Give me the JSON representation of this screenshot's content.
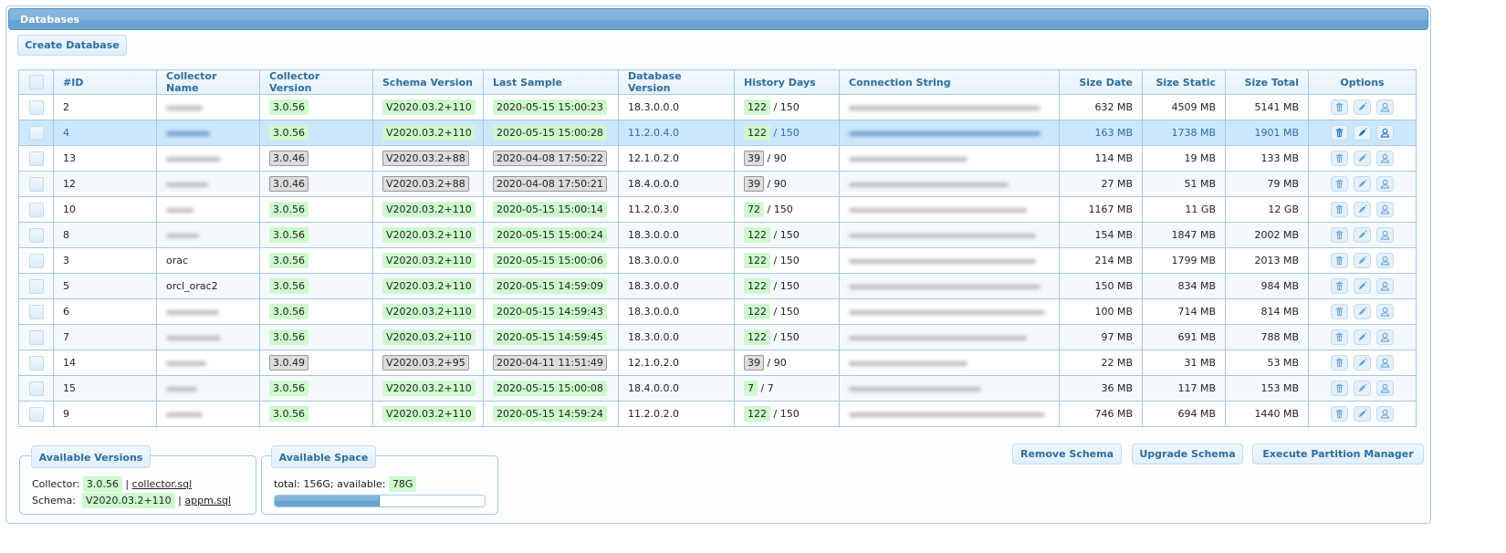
{
  "panel": {
    "title": "Databases"
  },
  "toolbar": {
    "create_label": "Create Database"
  },
  "table": {
    "columns": [
      "",
      "#ID",
      "Collector Name",
      "Collector Version",
      "Schema Version",
      "Last Sample",
      "Database Version",
      "History Days",
      "Connection String",
      "Size Date",
      "Size Static",
      "Size Total",
      "Options"
    ],
    "rows": [
      {
        "id": "2",
        "name": "",
        "name_hidden": true,
        "collector_version": "3.0.56",
        "collector_ok": true,
        "schema_version": "V2020.03.2+110",
        "schema_ok": true,
        "last_sample": "2020-05-15 15:00:23",
        "sample_ok": true,
        "db_version": "18.3.0.0.0",
        "history_days": "122",
        "history_max": "/ 150",
        "history_ok": true,
        "conn_hidden": true,
        "size_date": "632 MB",
        "size_static": "4509 MB",
        "size_total": "5141 MB"
      },
      {
        "id": "4",
        "name": "",
        "name_hidden": true,
        "selected": true,
        "collector_version": "3.0.56",
        "collector_ok": true,
        "schema_version": "V2020.03.2+110",
        "schema_ok": true,
        "last_sample": "2020-05-15 15:00:28",
        "sample_ok": true,
        "db_version": "11.2.0.4.0",
        "history_days": "122",
        "history_max": "/ 150",
        "history_ok": true,
        "conn_hidden": true,
        "size_date": "163 MB",
        "size_static": "1738 MB",
        "size_total": "1901 MB"
      },
      {
        "id": "13",
        "name": "",
        "name_hidden": true,
        "collector_version": "3.0.46",
        "collector_ok": false,
        "schema_version": "V2020.03.2+88",
        "schema_ok": false,
        "last_sample": "2020-04-08 17:50:22",
        "sample_ok": false,
        "db_version": "12.1.0.2.0",
        "history_days": "39",
        "history_max": "/ 90",
        "history_ok": false,
        "conn_hidden": true,
        "size_date": "114 MB",
        "size_static": "19 MB",
        "size_total": "133 MB"
      },
      {
        "id": "12",
        "name": "",
        "name_hidden": true,
        "collector_version": "3.0.46",
        "collector_ok": false,
        "schema_version": "V2020.03.2+88",
        "schema_ok": false,
        "last_sample": "2020-04-08 17:50:21",
        "sample_ok": false,
        "db_version": "18.4.0.0.0",
        "history_days": "39",
        "history_max": "/ 90",
        "history_ok": false,
        "conn_hidden": true,
        "size_date": "27 MB",
        "size_static": "51 MB",
        "size_total": "79 MB"
      },
      {
        "id": "10",
        "name": "",
        "name_hidden": true,
        "collector_version": "3.0.56",
        "collector_ok": true,
        "schema_version": "V2020.03.2+110",
        "schema_ok": true,
        "last_sample": "2020-05-15 15:00:14",
        "sample_ok": true,
        "db_version": "11.2.0.3.0",
        "history_days": "72",
        "history_max": "/ 150",
        "history_ok": true,
        "conn_hidden": true,
        "size_date": "1167 MB",
        "size_static": "11 GB",
        "size_total": "12 GB"
      },
      {
        "id": "8",
        "name": "",
        "name_hidden": true,
        "collector_version": "3.0.56",
        "collector_ok": true,
        "schema_version": "V2020.03.2+110",
        "schema_ok": true,
        "last_sample": "2020-05-15 15:00:24",
        "sample_ok": true,
        "db_version": "18.3.0.0.0",
        "history_days": "122",
        "history_max": "/ 150",
        "history_ok": true,
        "conn_hidden": true,
        "size_date": "154 MB",
        "size_static": "1847 MB",
        "size_total": "2002 MB"
      },
      {
        "id": "3",
        "name": "orac",
        "name_hidden": false,
        "collector_version": "3.0.56",
        "collector_ok": true,
        "schema_version": "V2020.03.2+110",
        "schema_ok": true,
        "last_sample": "2020-05-15 15:00:06",
        "sample_ok": true,
        "db_version": "18.3.0.0.0",
        "history_days": "122",
        "history_max": "/ 150",
        "history_ok": true,
        "conn_hidden": true,
        "size_date": "214 MB",
        "size_static": "1799 MB",
        "size_total": "2013 MB"
      },
      {
        "id": "5",
        "name": "orcl_orac2",
        "name_hidden": false,
        "collector_version": "3.0.56",
        "collector_ok": true,
        "schema_version": "V2020.03.2+110",
        "schema_ok": true,
        "last_sample": "2020-05-15 14:59:09",
        "sample_ok": true,
        "db_version": "18.3.0.0.0",
        "history_days": "122",
        "history_max": "/ 150",
        "history_ok": true,
        "conn_hidden": true,
        "size_date": "150 MB",
        "size_static": "834 MB",
        "size_total": "984 MB"
      },
      {
        "id": "6",
        "name": "",
        "name_hidden": true,
        "collector_version": "3.0.56",
        "collector_ok": true,
        "schema_version": "V2020.03.2+110",
        "schema_ok": true,
        "last_sample": "2020-05-15 14:59:43",
        "sample_ok": true,
        "db_version": "18.3.0.0.0",
        "history_days": "122",
        "history_max": "/ 150",
        "history_ok": true,
        "conn_hidden": true,
        "size_date": "100 MB",
        "size_static": "714 MB",
        "size_total": "814 MB"
      },
      {
        "id": "7",
        "name": "",
        "name_hidden": true,
        "collector_version": "3.0.56",
        "collector_ok": true,
        "schema_version": "V2020.03.2+110",
        "schema_ok": true,
        "last_sample": "2020-05-15 14:59:45",
        "sample_ok": true,
        "db_version": "18.3.0.0.0",
        "history_days": "122",
        "history_max": "/ 150",
        "history_ok": true,
        "conn_hidden": true,
        "size_date": "97 MB",
        "size_static": "691 MB",
        "size_total": "788 MB"
      },
      {
        "id": "14",
        "name": "",
        "name_hidden": true,
        "collector_version": "3.0.49",
        "collector_ok": false,
        "schema_version": "V2020.03.2+95",
        "schema_ok": false,
        "last_sample": "2020-04-11 11:51:49",
        "sample_ok": false,
        "db_version": "12.1.0.2.0",
        "history_days": "39",
        "history_max": "/ 90",
        "history_ok": false,
        "conn_hidden": true,
        "size_date": "22 MB",
        "size_static": "31 MB",
        "size_total": "53 MB"
      },
      {
        "id": "15",
        "name": "",
        "name_hidden": true,
        "collector_version": "3.0.56",
        "collector_ok": true,
        "schema_version": "V2020.03.2+110",
        "schema_ok": true,
        "last_sample": "2020-05-15 15:00:08",
        "sample_ok": true,
        "db_version": "18.4.0.0.0",
        "history_days": "7",
        "history_max": "/ 7",
        "history_ok": true,
        "conn_hidden": true,
        "size_date": "36 MB",
        "size_static": "117 MB",
        "size_total": "153 MB"
      },
      {
        "id": "9",
        "name": "",
        "name_hidden": true,
        "collector_version": "3.0.56",
        "collector_ok": true,
        "schema_version": "V2020.03.2+110",
        "schema_ok": true,
        "last_sample": "2020-05-15 14:59:24",
        "sample_ok": true,
        "db_version": "11.2.0.2.0",
        "history_days": "122",
        "history_max": "/ 150",
        "history_ok": true,
        "conn_hidden": true,
        "size_date": "746 MB",
        "size_static": "694 MB",
        "size_total": "1440 MB"
      }
    ],
    "row_options": [
      {
        "name": "delete",
        "icon": "trash-icon"
      },
      {
        "name": "edit",
        "icon": "pencil-icon"
      },
      {
        "name": "user",
        "icon": "person-icon"
      }
    ]
  },
  "versions": {
    "title": "Available Versions",
    "collector_label": "Collector:",
    "collector_version": "3.0.56",
    "collector_file": "collector.sql",
    "schema_label": "Schema:",
    "schema_version": "V2020.03.2+110",
    "schema_file": "appm.sql",
    "separator": "|"
  },
  "space": {
    "title": "Available Space",
    "summary": "total: 156G; available:",
    "available": "78G",
    "used_fraction": 0.5
  },
  "actions": {
    "remove_schema": "Remove Schema",
    "upgrade_schema": "Upgrade Schema",
    "execute_partition_manager": "Execute Partition Manager"
  }
}
